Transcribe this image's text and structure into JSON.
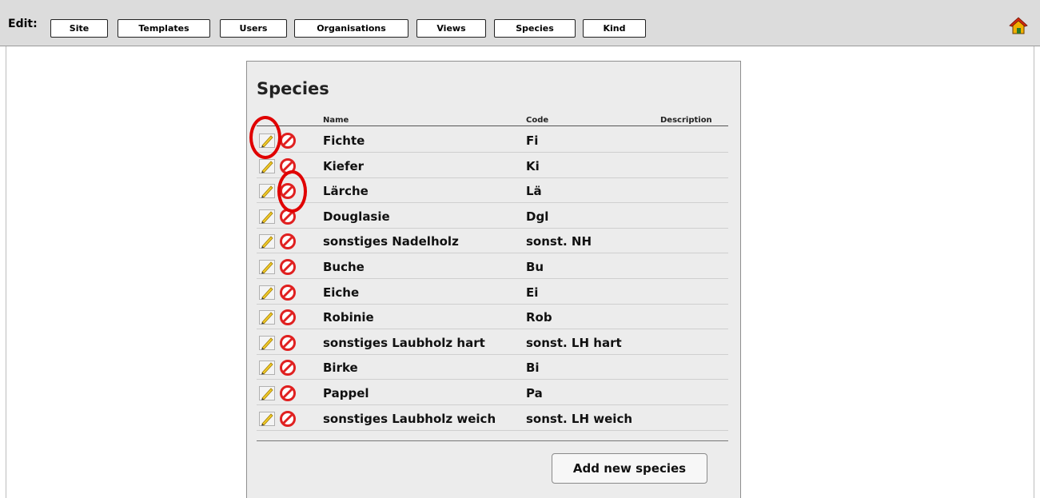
{
  "toolbar": {
    "edit_label": "Edit:",
    "buttons": [
      "Site",
      "Templates",
      "Users",
      "Organisations",
      "Views",
      "Species",
      "Kind"
    ],
    "home_icon": "home-icon"
  },
  "species_panel": {
    "title": "Species",
    "columns": {
      "name": "Name",
      "code": "Code",
      "description": "Description"
    },
    "rows": [
      {
        "name": "Fichte",
        "code": "Fi",
        "description": ""
      },
      {
        "name": "Kiefer",
        "code": "Ki",
        "description": ""
      },
      {
        "name": "Lärche",
        "code": "Lä",
        "description": ""
      },
      {
        "name": "Douglasie",
        "code": "Dgl",
        "description": ""
      },
      {
        "name": "sonstiges Nadelholz",
        "code": "sonst. NH",
        "description": ""
      },
      {
        "name": "Buche",
        "code": "Bu",
        "description": ""
      },
      {
        "name": "Eiche",
        "code": "Ei",
        "description": ""
      },
      {
        "name": "Robinie",
        "code": "Rob",
        "description": ""
      },
      {
        "name": "sonstiges Laubholz hart",
        "code": "sonst. LH hart",
        "description": ""
      },
      {
        "name": "Birke",
        "code": "Bi",
        "description": ""
      },
      {
        "name": "Pappel",
        "code": "Pa",
        "description": ""
      },
      {
        "name": "sonstiges Laubholz weich",
        "code": "sonst. LH weich",
        "description": ""
      }
    ],
    "add_button_label": "Add new species",
    "row_icons": [
      "pencil-icon",
      "delete-icon"
    ]
  },
  "colors": {
    "toolbar_bg": "#dcdcdc",
    "panel_bg": "#ececec",
    "highlight": "#e00000"
  }
}
